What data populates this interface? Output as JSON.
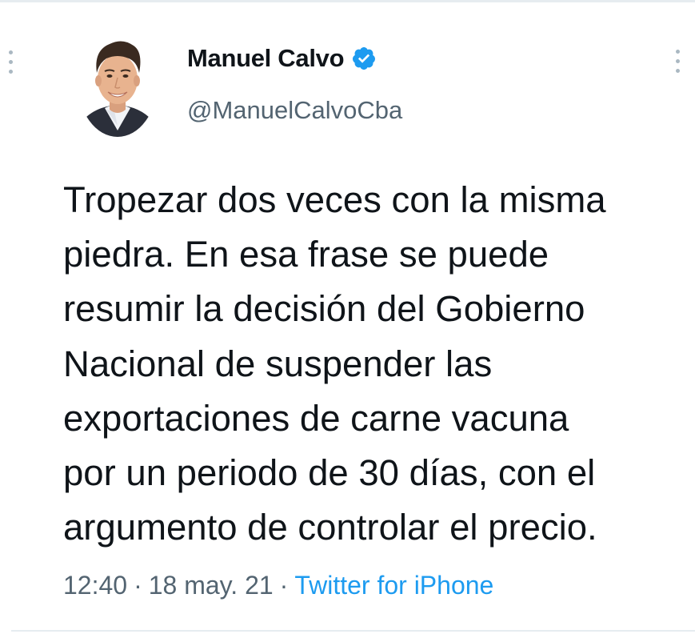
{
  "tweet": {
    "author": {
      "display_name": "Manuel Calvo",
      "handle": "@ManuelCalvoCba",
      "verified": true
    },
    "text_lines": [
      "Tropezar dos veces con la misma",
      "piedra. En esa frase se puede",
      "resumir la decisión del Gobierno",
      "Nacional de suspender las",
      "exportaciones de carne vacuna",
      "por un periodo de 30 días, con el",
      "argumento de controlar el precio."
    ],
    "time": "12:40",
    "separator": "·",
    "date": "18 may. 21",
    "source": "Twitter for iPhone"
  },
  "icons": {
    "verified": "verified-badge-icon",
    "menu": "more-vertical-icon"
  },
  "colors": {
    "text_primary": "#0f1419",
    "text_secondary": "#536471",
    "link": "#1d9bf0",
    "verified": "#1d9bf0",
    "divider": "#e6ecf0"
  }
}
